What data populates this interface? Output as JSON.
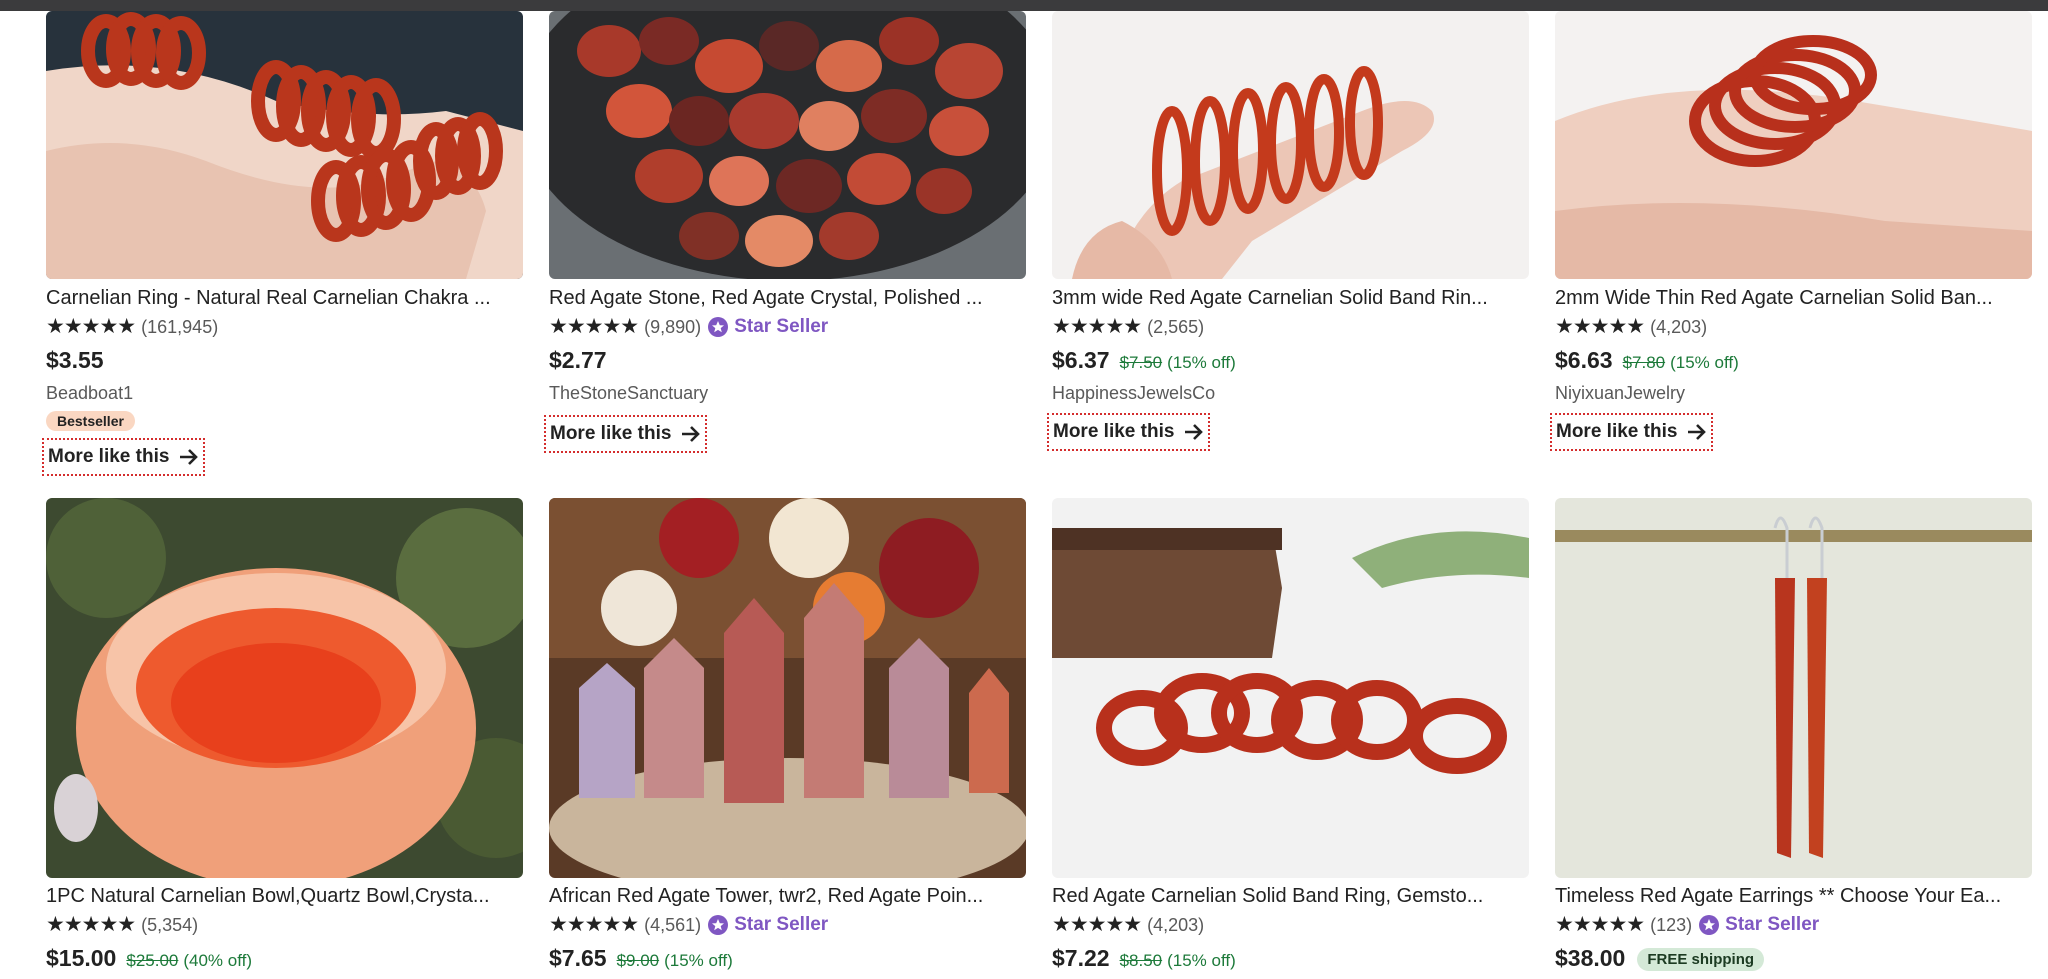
{
  "row1": [
    {
      "title": "Carnelian Ring - Natural Real Carnelian Chakra ...",
      "stars": "★★★★★",
      "count": "(161,945)",
      "star_seller": "",
      "price": "$3.55",
      "orig_price": "",
      "discount": "",
      "free_shipping": "",
      "shop": "Beadboat1",
      "bestseller": "Bestseller",
      "more": "More like this",
      "image": "hand-with-carnelian-rings-photo"
    },
    {
      "title": "Red Agate Stone, Red Agate Crystal, Polished ...",
      "stars": "★★★★★",
      "count": "(9,890)",
      "star_seller": "Star Seller",
      "price": "$2.77",
      "orig_price": "",
      "discount": "",
      "free_shipping": "",
      "shop": "TheStoneSanctuary",
      "bestseller": "",
      "more": "More like this",
      "image": "bowl-of-tumbled-red-agate-photo"
    },
    {
      "title": "3mm wide Red Agate Carnelian Solid Band Rin...",
      "stars": "★★★★★",
      "count": "(2,565)",
      "star_seller": "",
      "price": "$6.37",
      "orig_price": "$7.50",
      "discount": "(15% off)",
      "free_shipping": "",
      "shop": "HappinessJewelsCo",
      "bestseller": "",
      "more": "More like this",
      "image": "thin-red-rings-on-finger-photo"
    },
    {
      "title": "2mm Wide Thin Red Agate Carnelian Solid Ban...",
      "stars": "★★★★★",
      "count": "(4,203)",
      "star_seller": "",
      "price": "$6.63",
      "orig_price": "$7.80",
      "discount": "(15% off)",
      "free_shipping": "",
      "shop": "NiyixuanJewelry",
      "bestseller": "",
      "more": "More like this",
      "image": "stacked-red-rings-photo"
    }
  ],
  "row2": [
    {
      "title": "1PC Natural Carnelian Bowl,Quartz Bowl,Crysta...",
      "stars": "★★★★★",
      "count": "(5,354)",
      "star_seller": "",
      "price": "$15.00",
      "orig_price": "$25.00",
      "discount": "(40% off)",
      "free_shipping": "",
      "image": "carnelian-bowl-in-hand-photo"
    },
    {
      "title": "African Red Agate Tower, twr2, Red Agate Poin...",
      "stars": "★★★★★",
      "count": "(4,561)",
      "star_seller": "Star Seller",
      "price": "$7.65",
      "orig_price": "$9.00",
      "discount": "(15% off)",
      "free_shipping": "",
      "image": "agate-towers-with-flowers-photo"
    },
    {
      "title": "Red Agate Carnelian Solid Band Ring, Gemsto...",
      "stars": "★★★★★",
      "count": "(4,203)",
      "star_seller": "",
      "price": "$7.22",
      "orig_price": "$8.50",
      "discount": "(15% off)",
      "free_shipping": "",
      "image": "row-of-red-rings-photo"
    },
    {
      "title": "Timeless Red Agate Earrings ** Choose Your Ea...",
      "stars": "★★★★★",
      "count": "(123)",
      "star_seller": "Star Seller",
      "price": "$38.00",
      "orig_price": "",
      "discount": "",
      "free_shipping": "FREE shipping",
      "image": "long-red-agate-earrings-photo"
    }
  ],
  "colors": {
    "star_seller": "#7f57c2",
    "sale_green": "#1d7a3a",
    "bestseller_bg": "#fad7c2",
    "free_shipping_bg": "#d4e9d7",
    "focus_outline": "#d42d2d"
  }
}
